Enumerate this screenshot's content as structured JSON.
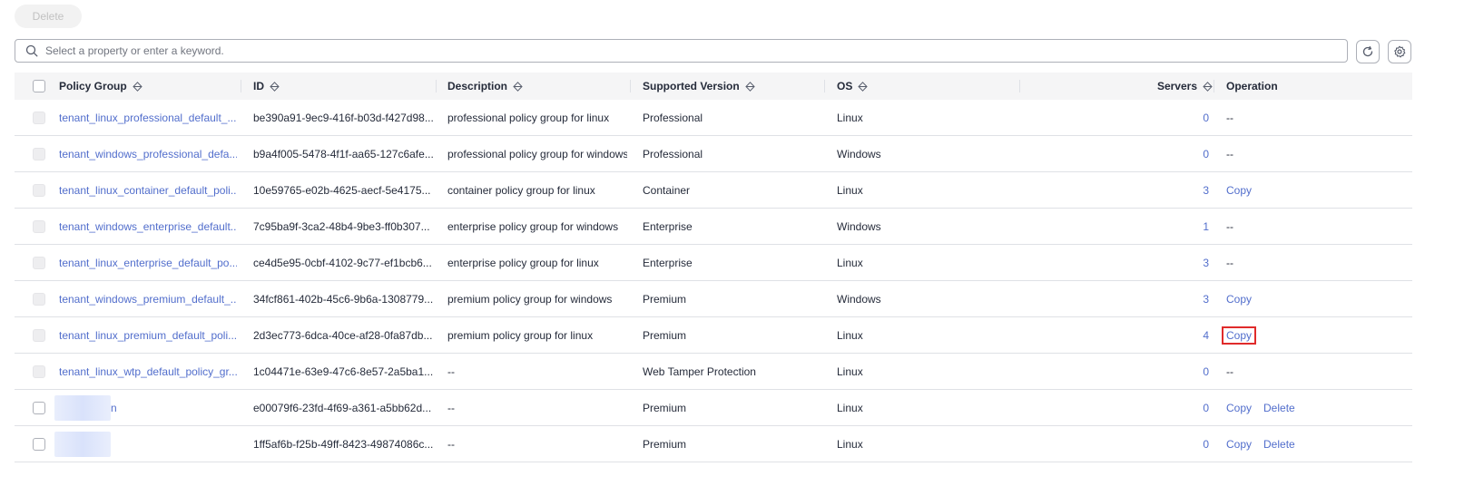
{
  "toolbar": {
    "delete_label": "Delete"
  },
  "search": {
    "placeholder": "Select a property or enter a keyword.",
    "value": ""
  },
  "table": {
    "headers": {
      "policy_group": "Policy Group",
      "id": "ID",
      "description": "Description",
      "supported_version": "Supported Version",
      "os": "OS",
      "servers": "Servers",
      "operation": "Operation"
    },
    "rows": [
      {
        "policy_group": "tenant_linux_professional_default_...",
        "id": "be390a91-9ec9-416f-b03d-f427d98...",
        "description": "professional policy group for linux",
        "version": "Professional",
        "os": "Linux",
        "servers": "0",
        "op_placeholder": "--",
        "copy": "",
        "delete": ""
      },
      {
        "policy_group": "tenant_windows_professional_defa...",
        "id": "b9a4f005-5478-4f1f-aa65-127c6afe...",
        "description": "professional policy group for windows",
        "version": "Professional",
        "os": "Windows",
        "servers": "0",
        "op_placeholder": "--",
        "copy": "",
        "delete": ""
      },
      {
        "policy_group": "tenant_linux_container_default_poli...",
        "id": "10e59765-e02b-4625-aecf-5e4175...",
        "description": "container policy group for linux",
        "version": "Container",
        "os": "Linux",
        "servers": "3",
        "op_placeholder": "",
        "copy": "Copy",
        "delete": ""
      },
      {
        "policy_group": "tenant_windows_enterprise_default...",
        "id": "7c95ba9f-3ca2-48b4-9be3-ff0b307...",
        "description": "enterprise policy group for windows",
        "version": "Enterprise",
        "os": "Windows",
        "servers": "1",
        "op_placeholder": "--",
        "copy": "",
        "delete": ""
      },
      {
        "policy_group": "tenant_linux_enterprise_default_po...",
        "id": "ce4d5e95-0cbf-4102-9c77-ef1bcb6...",
        "description": "enterprise policy group for linux",
        "version": "Enterprise",
        "os": "Linux",
        "servers": "3",
        "op_placeholder": "--",
        "copy": "",
        "delete": ""
      },
      {
        "policy_group": "tenant_windows_premium_default_...",
        "id": "34fcf861-402b-45c6-9b6a-1308779...",
        "description": "premium policy group for windows",
        "version": "Premium",
        "os": "Windows",
        "servers": "3",
        "op_placeholder": "",
        "copy": "Copy",
        "delete": ""
      },
      {
        "policy_group": "tenant_linux_premium_default_poli...",
        "id": "2d3ec773-6dca-40ce-af28-0fa87db...",
        "description": "premium policy group for linux",
        "version": "Premium",
        "os": "Linux",
        "servers": "4",
        "op_placeholder": "",
        "copy": "Copy",
        "delete": ""
      },
      {
        "policy_group": "tenant_linux_wtp_default_policy_gr...",
        "id": "1c04471e-63e9-47c6-8e57-2a5ba1...",
        "description": "--",
        "version": "Web Tamper Protection",
        "os": "Linux",
        "servers": "0",
        "op_placeholder": "--",
        "copy": "",
        "delete": ""
      },
      {
        "policy_group": "n",
        "id": "e00079f6-23fd-4f69-a361-a5bb62d...",
        "description": "--",
        "version": "Premium",
        "os": "Linux",
        "servers": "0",
        "op_placeholder": "",
        "copy": "Copy",
        "delete": "Delete"
      },
      {
        "policy_group": "",
        "id": "1ff5af6b-f25b-49ff-8423-49874086c...",
        "description": "--",
        "version": "Premium",
        "os": "Linux",
        "servers": "0",
        "op_placeholder": "",
        "copy": "Copy",
        "delete": "Delete"
      }
    ]
  },
  "colors": {
    "link": "#526ecc",
    "highlight_border": "#e02b2b",
    "header_bg": "#f5f5f6"
  },
  "icons": {
    "search": "search-icon",
    "refresh": "refresh-icon",
    "settings": "gear-icon",
    "sort": "sort-icon"
  }
}
